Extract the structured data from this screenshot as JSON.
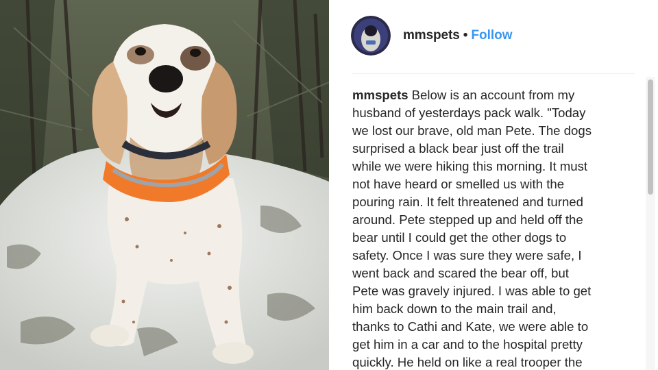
{
  "post": {
    "image_alt": "English setter dog with orange harness sitting on a snowy rock in the woods"
  },
  "header": {
    "avatar_icon": "profile-avatar-icon",
    "username": "mmspets",
    "separator": "•",
    "follow_label": "Follow"
  },
  "caption": {
    "username": "mmspets",
    "lines": [
      "Below is an account from my",
      "husband of yesterdays pack walk. \"Today",
      "we lost our brave, old man Pete. The dogs",
      "surprised a black bear just off the trail",
      "while we were hiking this morning. It must",
      "not have heard or smelled us with the",
      "pouring rain. It felt threatened and turned",
      "around. Pete stepped up and held off the",
      "bear until I could get the other dogs to",
      "safety. Once I was sure they were safe, I",
      "went back and scared the bear off, but",
      "Pete was gravely injured. I was able to get",
      "him back down to the main trail and,",
      "thanks to Cathi and Kate, we were able to",
      "get him in a car and to the hospital pretty",
      "quickly. He held on like a real trooper the"
    ]
  },
  "colors": {
    "follow": "#3897f0",
    "text": "#262626",
    "harness": "#f07a2a"
  }
}
